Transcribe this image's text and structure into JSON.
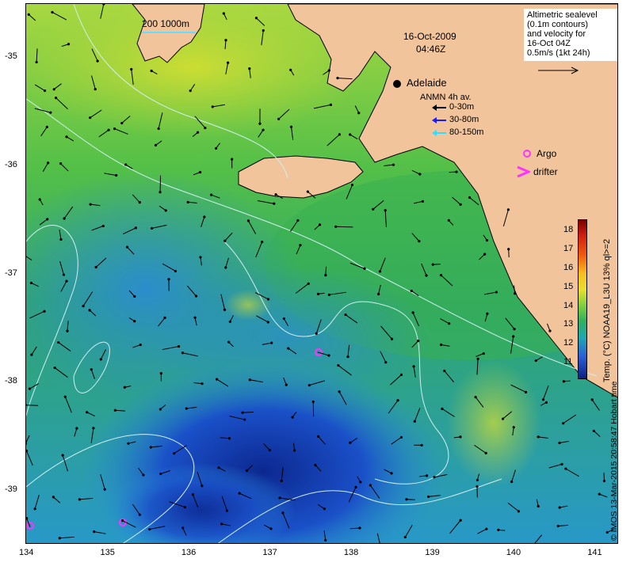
{
  "map": {
    "lon_ticks": [
      "134",
      "135",
      "136",
      "137",
      "138",
      "139",
      "140",
      "141"
    ],
    "lat_ticks": [
      "-35",
      "-36",
      "-37",
      "-38",
      "-39"
    ],
    "lon_range": [
      134,
      141.3
    ],
    "lat_range": [
      -34.5,
      -39.5
    ],
    "date_line1": "16-Oct-2009",
    "date_line2": "04:46Z",
    "scale_bar": "200  1000m",
    "city_name": "Adelaide",
    "colors": {
      "land": "#f2c49b",
      "cold": "#1030b0",
      "mid": "#38b050",
      "warm": "#e8e030"
    }
  },
  "info_box": {
    "line1": "Altimetric sealevel",
    "line2": "(0.1m contours)",
    "line3": "and velocity for",
    "line4": "16-Oct 04Z",
    "line5": "0.5m/s (1kt 24h)"
  },
  "legend": {
    "title": "ANMN 4h av.",
    "items": [
      {
        "label": "0-30m",
        "color": "#000000"
      },
      {
        "label": "30-80m",
        "color": "#1a1aff"
      },
      {
        "label": "80-150m",
        "color": "#33ddff"
      }
    ],
    "argo": "Argo",
    "drifter": "drifter"
  },
  "colorbar": {
    "ticks": [
      "18",
      "17",
      "16",
      "15",
      "14",
      "13",
      "12",
      "11"
    ],
    "title": "Temp. (°C) NOAA19_L3U 13% ql>=2",
    "range": [
      10.2,
      18.6
    ]
  },
  "credit": "© IMOS 13-Mar-2015 20:58:47 Hobart time"
}
